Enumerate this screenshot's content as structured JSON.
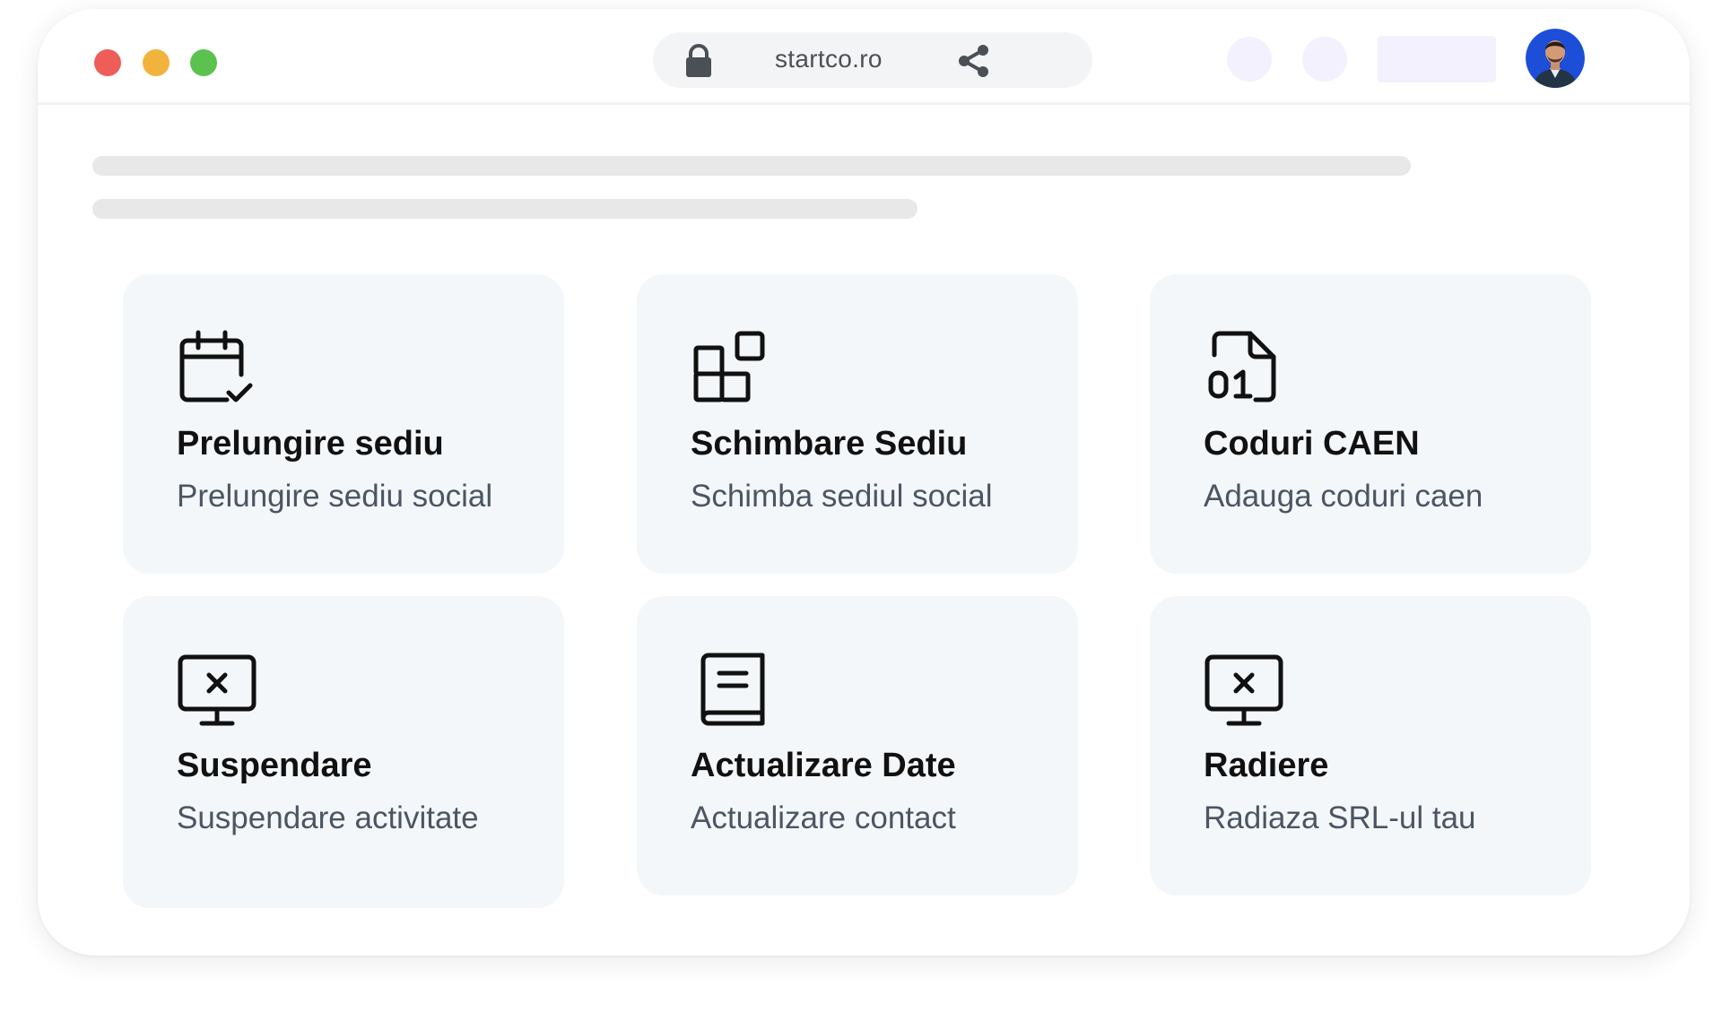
{
  "window": {
    "url": "startco.ro"
  },
  "colors": {
    "traffic_red": "#ee5d57",
    "traffic_yellow": "#f2b33d",
    "traffic_green": "#5cc24f",
    "placeholder_lavender": "#f3f1fd",
    "card_background": "#f4f7fa",
    "avatar_bg": "#1d4ed8"
  },
  "cards": [
    {
      "icon": "calendar-check-icon",
      "title": "Prelungire sediu",
      "subtitle": "Prelungire sediu social"
    },
    {
      "icon": "blocks-icon",
      "title": "Schimbare Sediu",
      "subtitle": "Schimba sediul social"
    },
    {
      "icon": "binary-file-icon",
      "title": "Coduri CAEN",
      "subtitle": "Adauga coduri caen"
    },
    {
      "icon": "monitor-x-icon",
      "title": "Suspendare",
      "subtitle": "Suspendare activitate"
    },
    {
      "icon": "book-icon",
      "title": "Actualizare Date",
      "subtitle": "Actualizare contact"
    },
    {
      "icon": "monitor-x-icon",
      "title": "Radiere",
      "subtitle": "Radiaza SRL-ul tau"
    }
  ]
}
